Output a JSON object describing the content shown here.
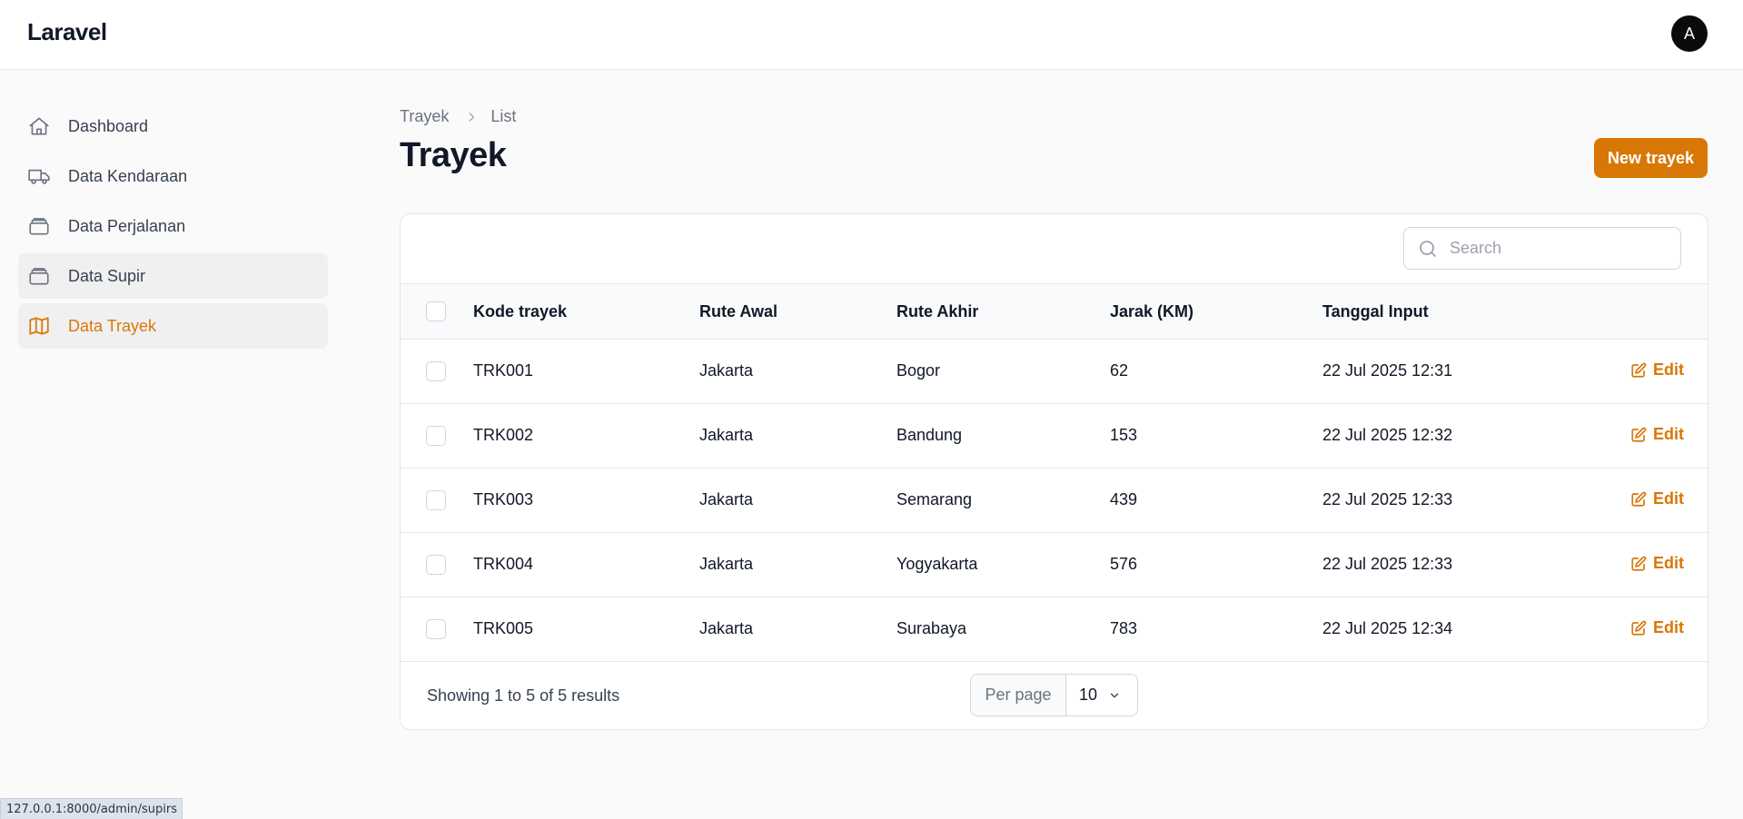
{
  "app": {
    "brand": "Laravel",
    "avatar_initial": "A"
  },
  "sidebar": {
    "items": [
      {
        "label": "Dashboard",
        "icon": "home-icon"
      },
      {
        "label": "Data Kendaraan",
        "icon": "truck-icon"
      },
      {
        "label": "Data Perjalanan",
        "icon": "stack-icon"
      },
      {
        "label": "Data Supir",
        "icon": "stack-icon"
      },
      {
        "label": "Data Trayek",
        "icon": "map-icon"
      }
    ]
  },
  "breadcrumb": {
    "parent": "Trayek",
    "current": "List"
  },
  "page": {
    "title": "Trayek",
    "new_button": "New trayek"
  },
  "search": {
    "placeholder": "Search"
  },
  "table": {
    "columns": [
      "Kode trayek",
      "Rute Awal",
      "Rute Akhir",
      "Jarak (KM)",
      "Tanggal Input"
    ],
    "rows": [
      {
        "kode": "TRK001",
        "awal": "Jakarta",
        "akhir": "Bogor",
        "jarak": "62",
        "tanggal": "22 Jul 2025 12:31",
        "action": "Edit"
      },
      {
        "kode": "TRK002",
        "awal": "Jakarta",
        "akhir": "Bandung",
        "jarak": "153",
        "tanggal": "22 Jul 2025 12:32",
        "action": "Edit"
      },
      {
        "kode": "TRK003",
        "awal": "Jakarta",
        "akhir": "Semarang",
        "jarak": "439",
        "tanggal": "22 Jul 2025 12:33",
        "action": "Edit"
      },
      {
        "kode": "TRK004",
        "awal": "Jakarta",
        "akhir": "Yogyakarta",
        "jarak": "576",
        "tanggal": "22 Jul 2025 12:33",
        "action": "Edit"
      },
      {
        "kode": "TRK005",
        "awal": "Jakarta",
        "akhir": "Surabaya",
        "jarak": "783",
        "tanggal": "22 Jul 2025 12:34",
        "action": "Edit"
      }
    ]
  },
  "pagination": {
    "summary": "Showing 1 to 5 of 5 results",
    "per_page_label": "Per page",
    "per_page_value": "10"
  },
  "status_bar": {
    "url": "127.0.0.1:8000/admin/supirs"
  },
  "colors": {
    "accent": "#d97706"
  }
}
